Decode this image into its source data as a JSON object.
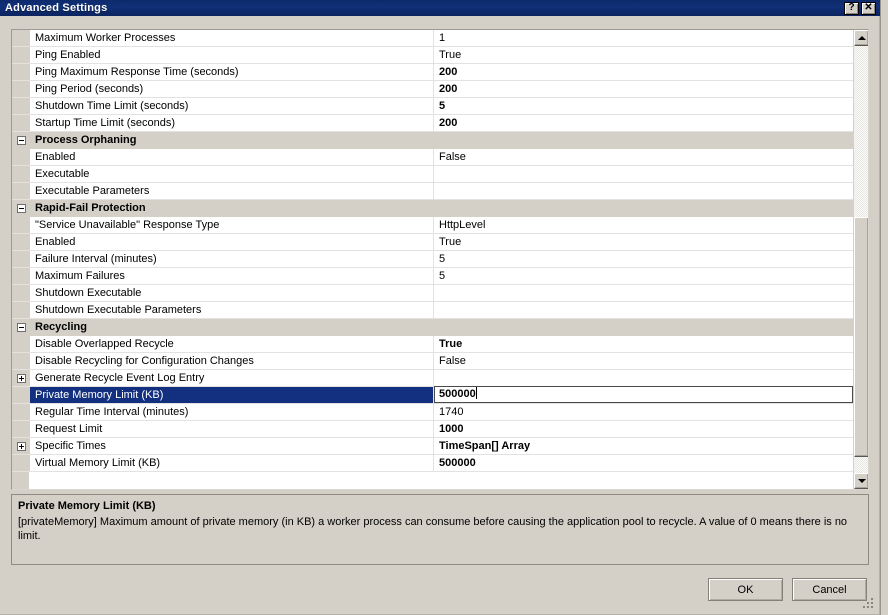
{
  "window": {
    "title": "Advanced Settings",
    "help_button": "?",
    "close_button": "✕",
    "background_window_sliver": "50"
  },
  "grid": {
    "rows": [
      {
        "kind": "property",
        "expander": "none",
        "name": "Maximum Worker Processes",
        "value": "1",
        "bold": false,
        "selected": false,
        "editing": false
      },
      {
        "kind": "property",
        "expander": "none",
        "name": "Ping Enabled",
        "value": "True",
        "bold": false,
        "selected": false,
        "editing": false
      },
      {
        "kind": "property",
        "expander": "none",
        "name": "Ping Maximum Response Time (seconds)",
        "value": "200",
        "bold": true,
        "selected": false,
        "editing": false
      },
      {
        "kind": "property",
        "expander": "none",
        "name": "Ping Period (seconds)",
        "value": "200",
        "bold": true,
        "selected": false,
        "editing": false
      },
      {
        "kind": "property",
        "expander": "none",
        "name": "Shutdown Time Limit (seconds)",
        "value": "5",
        "bold": true,
        "selected": false,
        "editing": false
      },
      {
        "kind": "property",
        "expander": "none",
        "name": "Startup Time Limit (seconds)",
        "value": "200",
        "bold": true,
        "selected": false,
        "editing": false
      },
      {
        "kind": "group",
        "expander": "minus",
        "name": "Process Orphaning",
        "value": "",
        "bold": false,
        "selected": false,
        "editing": false
      },
      {
        "kind": "property",
        "expander": "none",
        "name": "Enabled",
        "value": "False",
        "bold": false,
        "selected": false,
        "editing": false
      },
      {
        "kind": "property",
        "expander": "none",
        "name": "Executable",
        "value": "",
        "bold": false,
        "selected": false,
        "editing": false
      },
      {
        "kind": "property",
        "expander": "none",
        "name": "Executable Parameters",
        "value": "",
        "bold": false,
        "selected": false,
        "editing": false
      },
      {
        "kind": "group",
        "expander": "minus",
        "name": "Rapid-Fail Protection",
        "value": "",
        "bold": false,
        "selected": false,
        "editing": false
      },
      {
        "kind": "property",
        "expander": "none",
        "name": "\"Service Unavailable\" Response Type",
        "value": "HttpLevel",
        "bold": false,
        "selected": false,
        "editing": false
      },
      {
        "kind": "property",
        "expander": "none",
        "name": "Enabled",
        "value": "True",
        "bold": false,
        "selected": false,
        "editing": false
      },
      {
        "kind": "property",
        "expander": "none",
        "name": "Failure Interval (minutes)",
        "value": "5",
        "bold": false,
        "selected": false,
        "editing": false
      },
      {
        "kind": "property",
        "expander": "none",
        "name": "Maximum Failures",
        "value": "5",
        "bold": false,
        "selected": false,
        "editing": false
      },
      {
        "kind": "property",
        "expander": "none",
        "name": "Shutdown Executable",
        "value": "",
        "bold": false,
        "selected": false,
        "editing": false
      },
      {
        "kind": "property",
        "expander": "none",
        "name": "Shutdown Executable Parameters",
        "value": "",
        "bold": false,
        "selected": false,
        "editing": false
      },
      {
        "kind": "group",
        "expander": "minus",
        "name": "Recycling",
        "value": "",
        "bold": false,
        "selected": false,
        "editing": false
      },
      {
        "kind": "property",
        "expander": "none",
        "name": "Disable Overlapped Recycle",
        "value": "True",
        "bold": true,
        "selected": false,
        "editing": false
      },
      {
        "kind": "property",
        "expander": "none",
        "name": "Disable Recycling for Configuration Changes",
        "value": "False",
        "bold": false,
        "selected": false,
        "editing": false
      },
      {
        "kind": "property",
        "expander": "plus",
        "name": "Generate Recycle Event Log Entry",
        "value": "",
        "bold": false,
        "selected": false,
        "editing": false
      },
      {
        "kind": "property",
        "expander": "none",
        "name": "Private Memory Limit (KB)",
        "value": "500000",
        "bold": true,
        "selected": true,
        "editing": true
      },
      {
        "kind": "property",
        "expander": "none",
        "name": "Regular Time Interval (minutes)",
        "value": "1740",
        "bold": false,
        "selected": false,
        "editing": false
      },
      {
        "kind": "property",
        "expander": "none",
        "name": "Request Limit",
        "value": "1000",
        "bold": true,
        "selected": false,
        "editing": false
      },
      {
        "kind": "property",
        "expander": "plus",
        "name": "Specific Times",
        "value": "TimeSpan[] Array",
        "bold": true,
        "selected": false,
        "editing": false
      },
      {
        "kind": "property",
        "expander": "none",
        "name": "Virtual Memory Limit (KB)",
        "value": "500000",
        "bold": true,
        "selected": false,
        "editing": false
      }
    ]
  },
  "scrollbar": {
    "up_arrow": "scroll-up",
    "down_arrow": "scroll-down"
  },
  "description": {
    "title": "Private Memory Limit (KB)",
    "body": "[privateMemory] Maximum amount of private memory (in KB) a worker process can consume before causing the application pool to recycle.  A value of 0 means there is no limit."
  },
  "footer": {
    "ok_label": "OK",
    "cancel_label": "Cancel"
  }
}
